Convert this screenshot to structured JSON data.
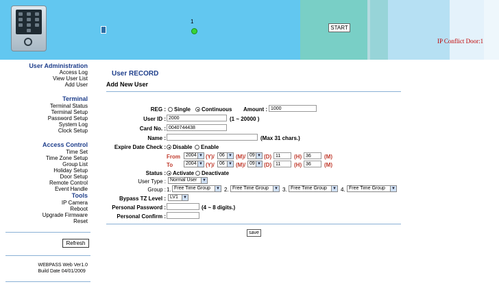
{
  "header": {
    "door_number": "1",
    "start_label": "START",
    "conflict_text": "IP Conflict Door:1"
  },
  "sidebar": {
    "sections": [
      {
        "title": "User Administration",
        "items": [
          "Access Log",
          "View User List",
          "Add User"
        ]
      },
      {
        "title": "Terminal",
        "items": [
          "Terminal Status",
          "Terminal Setup",
          "Password Setup",
          "System Log",
          "Clock Setup"
        ]
      },
      {
        "title": "Access Control",
        "items": [
          "Time Set",
          "Time Zone Setup",
          "Group List",
          "Holiday Setup",
          "Door Setup",
          "Remote Control",
          "Event Handle"
        ]
      },
      {
        "title": "Tools",
        "items": [
          "IP Camera",
          "Reboot",
          "Upgrade Firmware",
          "Reset"
        ]
      }
    ],
    "refresh_label": "Refresh",
    "version_line1": "WEBPASS Web Ver1.0",
    "version_line2": "Build Date 04/01/2009"
  },
  "form": {
    "title": "User RECORD",
    "subtitle": "Add New User",
    "reg": {
      "label": "REG :",
      "single": "Single",
      "continuous": "Continuous",
      "amount_label": "Amount :",
      "amount_value": "1000"
    },
    "user_id": {
      "label": "User ID :",
      "value": "2000",
      "hint": "(1 ~ 20000 )"
    },
    "card_no": {
      "label": "Card No. :",
      "value": "0040744438"
    },
    "name": {
      "label": "Name :",
      "value": "",
      "hint": "(Max 31 chars.)"
    },
    "expire": {
      "label": "Expire Date Check :",
      "disable": "Disable",
      "enable": "Enable",
      "from_label": "From",
      "to_label": "To",
      "from": {
        "year": "2004",
        "month": "06",
        "day": "09",
        "hour": "11",
        "minute": "36"
      },
      "to": {
        "year": "2004",
        "month": "06",
        "day": "09",
        "hour": "11",
        "minute": "36"
      },
      "unit_y": "(Y)/",
      "unit_m": "(M)/",
      "unit_d": "(D)",
      "unit_h": "(H)",
      "unit_min": "(M)"
    },
    "status": {
      "label": "Status :",
      "activate": "Activate",
      "deactivate": "Deactivate"
    },
    "user_type": {
      "label": "User Type :",
      "value": "Normal User"
    },
    "group": {
      "label": "Group :",
      "slots": [
        {
          "num": "1.",
          "value": "Free Time Group"
        },
        {
          "num": "2.",
          "value": "Free Time Group"
        },
        {
          "num": "3.",
          "value": "Free Time Group"
        },
        {
          "num": "4.",
          "value": "Free Time Group"
        }
      ]
    },
    "bypass": {
      "label": "Bypass TZ Level :",
      "value": "LV1"
    },
    "password": {
      "label": "Personal Password :",
      "hint": "(4 ~ 8 digits.)"
    },
    "confirm": {
      "label": "Personal Confirm :"
    },
    "save_label": "save"
  }
}
